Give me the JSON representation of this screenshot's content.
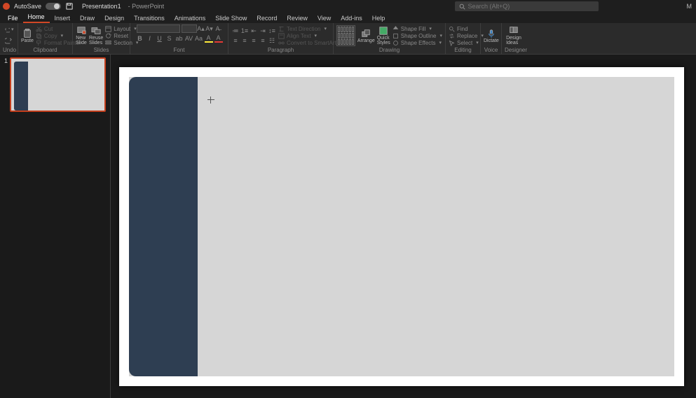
{
  "titlebar": {
    "autosave": "AutoSave",
    "autosave_state": "Off",
    "doc": "Presentation1",
    "app": "PowerPoint",
    "search_placeholder": "Search (Alt+Q)",
    "account_initial": "M"
  },
  "tabs": {
    "file": "File",
    "home": "Home",
    "insert": "Insert",
    "draw": "Draw",
    "design": "Design",
    "transitions": "Transitions",
    "animations": "Animations",
    "slideshow": "Slide Show",
    "record": "Record",
    "review": "Review",
    "view": "View",
    "addins": "Add-ins",
    "help": "Help"
  },
  "ribbon": {
    "undo": {
      "label": "Undo"
    },
    "clipboard": {
      "label": "Clipboard",
      "paste": "Paste",
      "cut": "Cut",
      "copy": "Copy",
      "format_painter": "Format Painter"
    },
    "slides": {
      "label": "Slides",
      "new_slide": "New\nSlide",
      "reuse": "Reuse\nSlides",
      "layout": "Layout",
      "reset": "Reset",
      "section": "Section"
    },
    "font": {
      "label": "Font"
    },
    "paragraph": {
      "label": "Paragraph",
      "text_direction": "Text Direction",
      "align_text": "Align Text",
      "convert": "Convert to SmartArt"
    },
    "drawing": {
      "label": "Drawing",
      "arrange": "Arrange",
      "styles": "Quick\nStyles",
      "shape_fill": "Shape Fill",
      "shape_outline": "Shape Outline",
      "shape_effects": "Shape Effects"
    },
    "editing": {
      "label": "Editing",
      "find": "Find",
      "replace": "Replace",
      "select": "Select"
    },
    "voice": {
      "label": "Voice",
      "dictate": "Dictate"
    },
    "designer": {
      "label": "Designer",
      "design_ideas": "Design\nIdeas"
    }
  },
  "thumbnails": {
    "slide1_num": "1"
  },
  "colors": {
    "accent": "#c43e1c",
    "shape": "#2e3e52",
    "canvas": "#d6d6d6"
  }
}
